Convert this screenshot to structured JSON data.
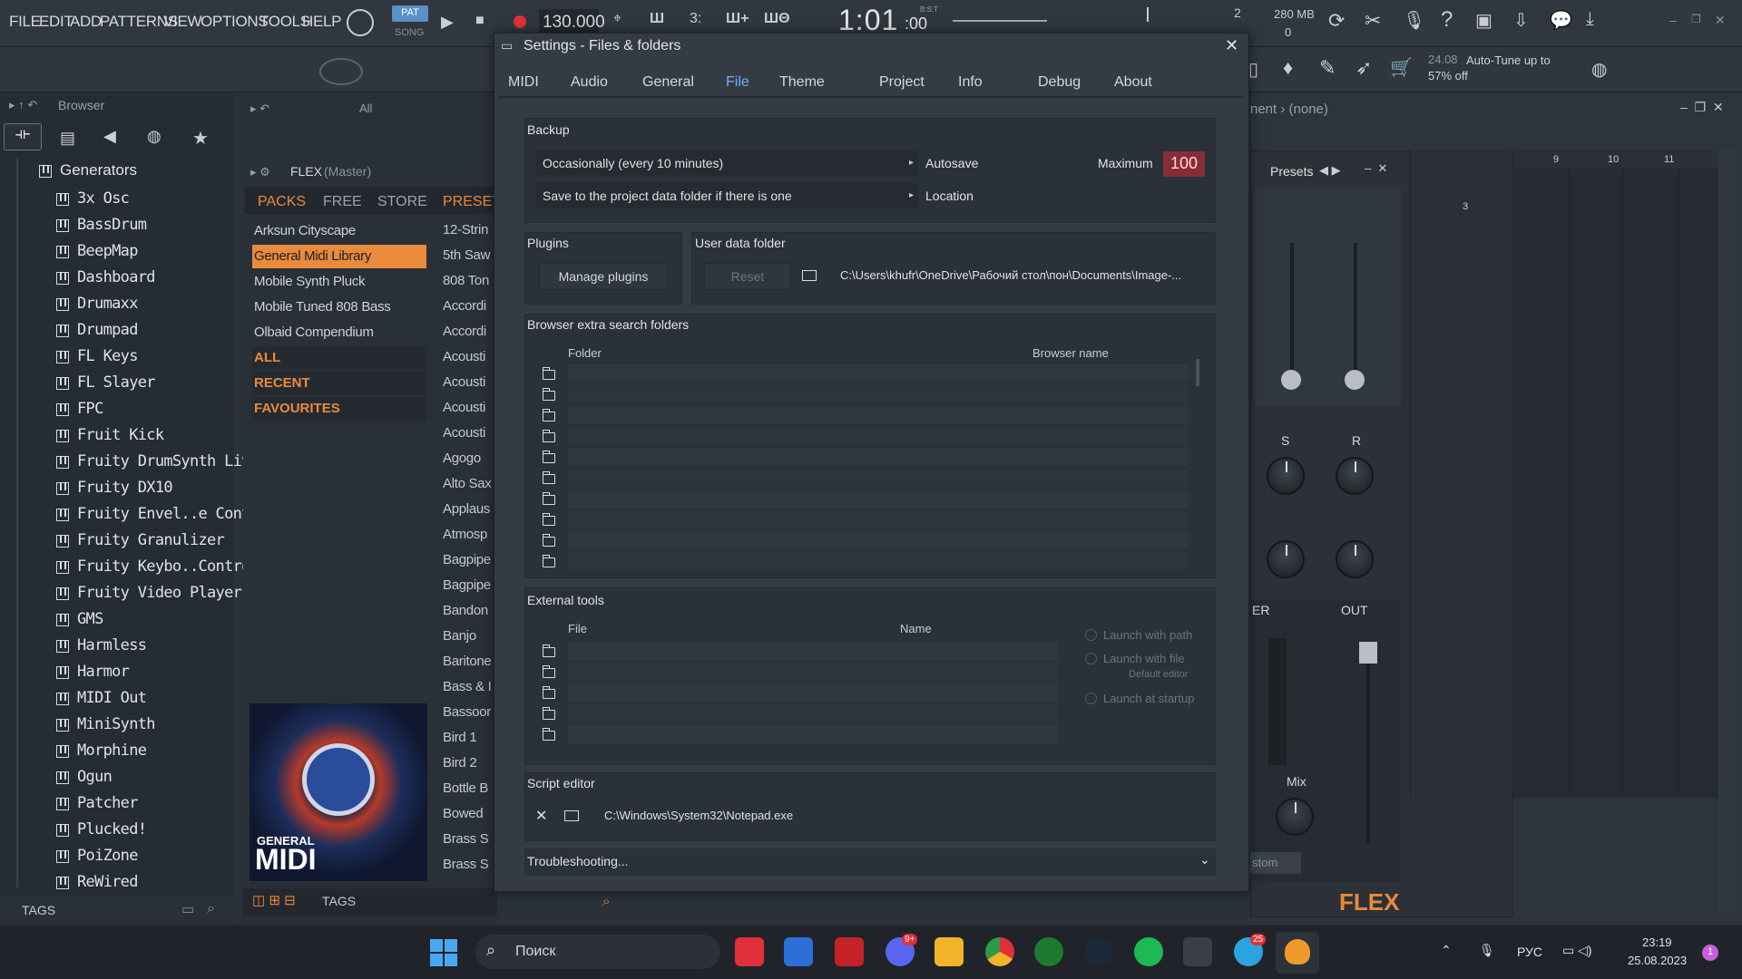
{
  "menu": [
    "FILE",
    "EDIT",
    "ADD",
    "PATTERNS",
    "VIEW",
    "OPTIONS",
    "TOOLS",
    "HELP"
  ],
  "transport": {
    "mode_pat": "PAT",
    "mode_song": "SONG",
    "tempo": "130.000",
    "position": "1:01",
    "position_sub": ":00",
    "position_label": "B:S:T",
    "pattern_num": "2"
  },
  "memory": {
    "mb": "280 MB",
    "cpu": "0"
  },
  "hint": {
    "version": "24.08",
    "text": "Auto-Tune up to 57% off"
  },
  "browser": {
    "title": "Browser",
    "section": "Generators",
    "items": [
      "3x Osc",
      "BassDrum",
      "BeepMap",
      "Dashboard",
      "Drumaxx",
      "Drumpad",
      "FL Keys",
      "FL Slayer",
      "FPC",
      "Fruit Kick",
      "Fruity DrumSynth Live",
      "Fruity DX10",
      "Fruity Envel..e Controller",
      "Fruity Granulizer",
      "Fruity Keybo..Controller",
      "Fruity Video Player",
      "GMS",
      "Harmless",
      "Harmor",
      "MIDI Out",
      "MiniSynth",
      "Morphine",
      "Ogun",
      "Patcher",
      "Plucked!",
      "PoiZone",
      "ReWired"
    ],
    "tags_label": "TAGS"
  },
  "flex": {
    "title": "FLEX",
    "subtitle": "(Master)",
    "filter": "All",
    "tabs": [
      "PACKS",
      "FREE",
      "STORE",
      "PRESET"
    ],
    "packs": [
      "Arksun Cityscape",
      "General Midi Library",
      "Mobile Synth Pluck",
      "Mobile Tuned 808 Bass",
      "Olbaid Compendium"
    ],
    "categories": [
      "ALL",
      "RECENT",
      "FAVOURITES"
    ],
    "presets": [
      "12-Strin",
      "5th Saw",
      "808 Ton",
      "Accordi",
      "Accordi",
      "Acousti",
      "Acousti",
      "Acousti",
      "Acousti",
      "Agogo",
      "Alto Sax",
      "Applaus",
      "Atmosp",
      "Bagpipe",
      "Bagpipe",
      "Bandon",
      "Banjo",
      "Baritone",
      "Bass & I",
      "Bassoor",
      "Bird 1",
      "Bird 2",
      "Bottle B",
      "Bowed",
      "Brass S",
      "Brass S"
    ],
    "cover_line1": "GENERAL",
    "cover_line2": "MIDI",
    "tags_label": "TAGS"
  },
  "dialog": {
    "title": "Settings - Files & folders",
    "tabs": [
      "MIDI",
      "Audio",
      "General",
      "File",
      "Theme",
      "Project",
      "Info",
      "Debug",
      "About"
    ],
    "active_tab": "File",
    "backup": {
      "title": "Backup",
      "autosave_value": "Occasionally (every 10 minutes)",
      "autosave_label": "Autosave",
      "maximum_label": "Maximum",
      "maximum_value": "100",
      "location_value": "Save to the project data folder if there is one",
      "location_label": "Location"
    },
    "plugins": {
      "title": "Plugins",
      "manage": "Manage plugins"
    },
    "user_data": {
      "title": "User data folder",
      "reset": "Reset",
      "path": "C:\\Users\\khufr\\OneDrive\\Рабочий стол\\пон\\Documents\\Image-..."
    },
    "browser_folders": {
      "title": "Browser extra search folders",
      "col_folder": "Folder",
      "col_name": "Browser name"
    },
    "external_tools": {
      "title": "External tools",
      "col_file": "File",
      "col_name": "Name",
      "opt1": "Launch with path",
      "opt2": "Launch with file",
      "opt2_sub": "Default editor",
      "opt3": "Launch at startup"
    },
    "script_editor": {
      "title": "Script editor",
      "path": "C:\\Windows\\System32\\Notepad.exe"
    },
    "troubleshooting": "Troubleshooting..."
  },
  "mixer": {
    "presets_label": "Presets",
    "knob_s": "S",
    "knob_r": "R",
    "out_label": "OUT",
    "er_label": "ER",
    "mix_label": "Mix",
    "custom_label": "stom",
    "brand": "FLEX",
    "breadcrumb": "nent › (none)",
    "ruler": [
      "9",
      "10",
      "11"
    ],
    "pattern_num": "3"
  },
  "taskbar": {
    "search": "Поиск",
    "lang": "РУС",
    "time": "23:19",
    "date": "25.08.2023",
    "discord_badge": "9+",
    "telegram_badge": "25",
    "notif": "1"
  }
}
